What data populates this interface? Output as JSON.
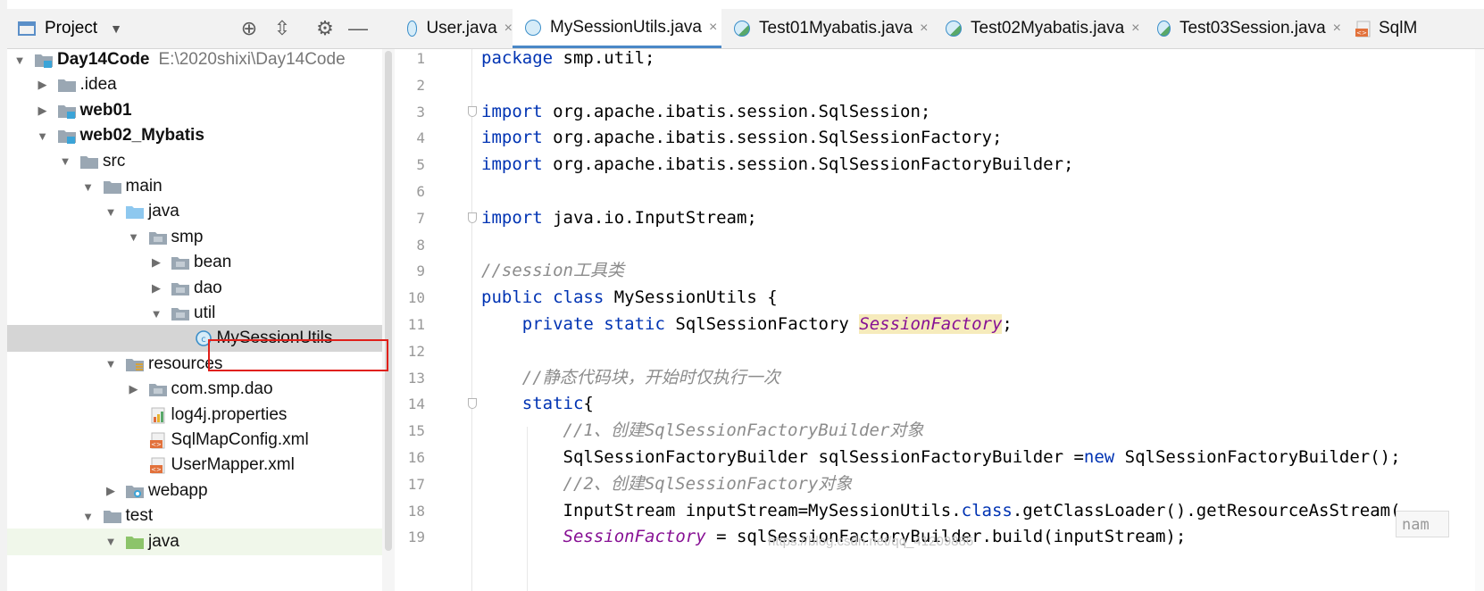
{
  "project_panel": {
    "title": "Project",
    "icons": [
      "dropdown-arrow-icon",
      "locate-icon",
      "collapse-all-icon",
      "gear-icon",
      "hide-icon"
    ],
    "tree": [
      {
        "label": "Day14Code",
        "path": "E:\\2020shixi\\Day14Code",
        "bold": true,
        "icon": "module-folder-icon",
        "arrow": "expanded"
      },
      {
        "label": ".idea",
        "icon": "folder-icon",
        "arrow": "collapsed"
      },
      {
        "label": "web01",
        "bold": true,
        "icon": "module-folder-icon",
        "arrow": "collapsed"
      },
      {
        "label": "web02_Mybatis",
        "bold": true,
        "icon": "module-folder-icon",
        "arrow": "expanded"
      },
      {
        "label": "src",
        "icon": "folder-icon",
        "arrow": "expanded"
      },
      {
        "label": "main",
        "icon": "folder-icon",
        "arrow": "expanded"
      },
      {
        "label": "java",
        "icon": "source-folder-icon",
        "arrow": "expanded"
      },
      {
        "label": "smp",
        "icon": "package-icon",
        "arrow": "expanded"
      },
      {
        "label": "bean",
        "icon": "package-icon",
        "arrow": "collapsed"
      },
      {
        "label": "dao",
        "icon": "package-icon",
        "arrow": "collapsed"
      },
      {
        "label": "util",
        "icon": "package-icon",
        "arrow": "expanded"
      },
      {
        "label": "MySessionUtils",
        "icon": "java-class-icon",
        "selected": true
      },
      {
        "label": "resources",
        "icon": "resources-folder-icon",
        "arrow": "expanded"
      },
      {
        "label": "com.smp.dao",
        "icon": "package-icon",
        "arrow": "collapsed"
      },
      {
        "label": "log4j.properties",
        "icon": "properties-file-icon"
      },
      {
        "label": "SqlMapConfig.xml",
        "icon": "xml-file-icon"
      },
      {
        "label": "UserMapper.xml",
        "icon": "xml-file-icon"
      },
      {
        "label": "webapp",
        "icon": "web-folder-icon",
        "arrow": "collapsed"
      },
      {
        "label": "test",
        "icon": "folder-icon",
        "arrow": "expanded"
      },
      {
        "label": "java",
        "icon": "test-source-folder-icon",
        "arrow": "expanded",
        "test": true
      }
    ]
  },
  "tabs": [
    {
      "label": "User.java",
      "icon": "java-class-icon"
    },
    {
      "label": "MySessionUtils.java",
      "icon": "java-class-icon",
      "active": true
    },
    {
      "label": "Test01Myabatis.java",
      "icon": "java-test-class-icon"
    },
    {
      "label": "Test02Myabatis.java",
      "icon": "java-test-class-icon"
    },
    {
      "label": "Test03Session.java",
      "icon": "java-test-class-icon"
    },
    {
      "label": "SqlM",
      "icon": "xml-file-icon"
    }
  ],
  "editor": {
    "line_numbers": [
      "1",
      "2",
      "3",
      "4",
      "5",
      "6",
      "7",
      "8",
      "9",
      "10",
      "11",
      "12",
      "13",
      "14",
      "15",
      "16",
      "17",
      "18",
      "19"
    ],
    "lines": [
      [
        [
          "kw",
          "package"
        ],
        [
          "t",
          " smp.util;"
        ]
      ],
      [],
      [
        [
          "kw",
          "import"
        ],
        [
          "t",
          " org.apache.ibatis.session.SqlSession;"
        ]
      ],
      [
        [
          "kw",
          "import"
        ],
        [
          "t",
          " org.apache.ibatis.session.SqlSessionFactory;"
        ]
      ],
      [
        [
          "kw",
          "import"
        ],
        [
          "t",
          " org.apache.ibatis.session.SqlSessionFactoryBuilder;"
        ]
      ],
      [],
      [
        [
          "kw",
          "import"
        ],
        [
          "t",
          " java.io.InputStream;"
        ]
      ],
      [],
      [
        [
          "cm",
          "//session工具类"
        ]
      ],
      [
        [
          "kw",
          "public class"
        ],
        [
          "t",
          " MySessionUtils {"
        ]
      ],
      [
        [
          "t",
          "    "
        ],
        [
          "kw",
          "private static"
        ],
        [
          "t",
          " SqlSessionFactory "
        ],
        [
          "fldhl",
          "SessionFactory"
        ],
        [
          "t",
          ";"
        ]
      ],
      [],
      [
        [
          "t",
          "    "
        ],
        [
          "cm",
          "//静态代码块，开始时仅执行一次"
        ]
      ],
      [
        [
          "t",
          "    "
        ],
        [
          "kw",
          "static"
        ],
        [
          "t",
          "{"
        ]
      ],
      [
        [
          "t",
          "        "
        ],
        [
          "cm",
          "//1、创建SqlSessionFactoryBuilder对象"
        ]
      ],
      [
        [
          "t",
          "        SqlSessionFactoryBuilder sqlSessionFactoryBuilder ="
        ],
        [
          "kw",
          "new"
        ],
        [
          "t",
          " SqlSessionFactoryBuilder();"
        ]
      ],
      [
        [
          "t",
          "        "
        ],
        [
          "cm",
          "//2、创建SqlSessionFactory对象"
        ]
      ],
      [
        [
          "t",
          "        InputStream inputStream=MySessionUtils."
        ],
        [
          "kw",
          "class"
        ],
        [
          "t",
          ".getClassLoader().getResourceAsStream("
        ]
      ],
      [
        [
          "t",
          "        "
        ],
        [
          "fld",
          "SessionFactory"
        ],
        [
          "t",
          " = sqlSessionFactoryBuilder.build(inputStream);"
        ]
      ]
    ],
    "param_hint": "nam",
    "watermark": "https://blog.csdn.net/qq_41209886"
  }
}
